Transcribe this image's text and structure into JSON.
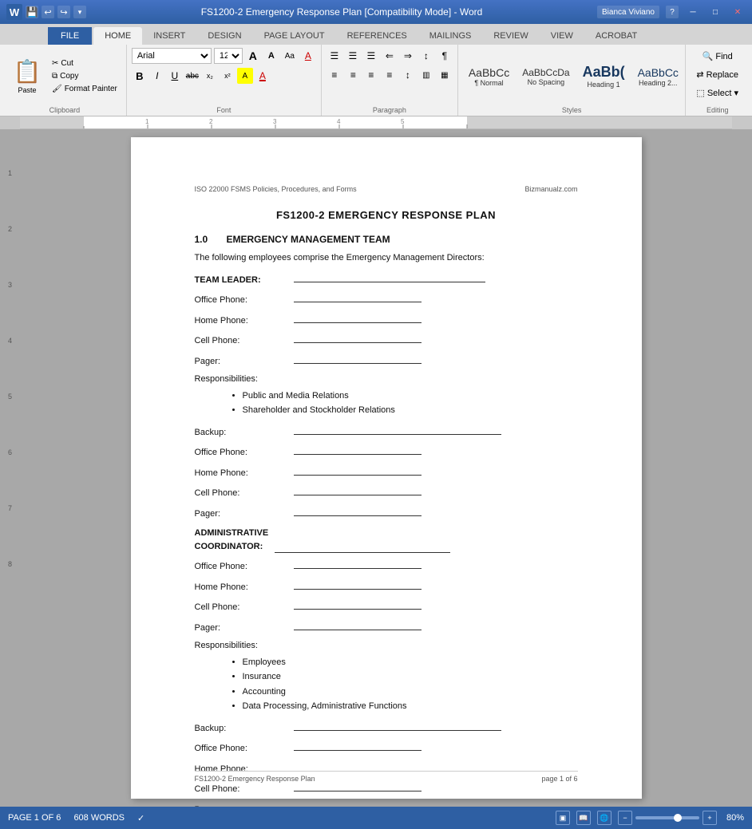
{
  "titleBar": {
    "appIcon": "W",
    "quickAccess": [
      "save",
      "undo",
      "redo",
      "customize"
    ],
    "title": "FS1200-2 Emergency Response Plan [Compatibility Mode] - Word",
    "userMenu": "Bianca Viviano",
    "windowBtns": [
      "help",
      "minimize",
      "maximize",
      "close"
    ]
  },
  "ribbon": {
    "tabs": [
      "FILE",
      "HOME",
      "INSERT",
      "DESIGN",
      "PAGE LAYOUT",
      "REFERENCES",
      "MAILINGS",
      "REVIEW",
      "VIEW",
      "ACROBAT"
    ],
    "activeTab": "HOME"
  },
  "clipboardGroup": {
    "label": "Clipboard",
    "pasteLabel": "Paste",
    "cutLabel": "Cut",
    "copyLabel": "Copy",
    "formatPainterLabel": "Format Painter"
  },
  "fontGroup": {
    "label": "Font",
    "fontName": "Arial",
    "fontSize": "12",
    "growLabel": "A",
    "shrinkLabel": "A",
    "caseLabel": "Aa",
    "clearLabel": "A",
    "boldLabel": "B",
    "italicLabel": "I",
    "underlineLabel": "U",
    "strikeLabel": "abc",
    "subscriptLabel": "x₂",
    "superscriptLabel": "x²",
    "highlightLabel": "A",
    "fontColorLabel": "A"
  },
  "paragraphGroup": {
    "label": "Paragraph",
    "bulletsLabel": "≡",
    "numbersLabel": "≡",
    "multiLabel": "≡",
    "decreaseLabel": "←",
    "increaseLabel": "→",
    "sortLabel": "↕",
    "showLabel": "¶",
    "alignLeftLabel": "≡",
    "centerLabel": "≡",
    "alignRightLabel": "≡",
    "justifyLabel": "≡",
    "lineSpacingLabel": "↕",
    "shadingLabel": "▥",
    "bordersLabel": "▦"
  },
  "stylesGroup": {
    "label": "Styles",
    "items": [
      {
        "name": "Normal",
        "preview": "AaBbCc",
        "label": "¶ Normal"
      },
      {
        "name": "NoSpacing",
        "preview": "AaBbCcDa",
        "label": "No Spacing"
      },
      {
        "name": "Heading1",
        "preview": "AaBb(",
        "label": "Heading 1"
      },
      {
        "name": "Heading2",
        "preview": "AaBbCc",
        "label": "Heading 2..."
      }
    ],
    "scrollUpLabel": "▲",
    "scrollDownLabel": "▼",
    "moreLabel": "▼"
  },
  "editingGroup": {
    "label": "Editing",
    "findLabel": "Find",
    "replaceLabel": "Replace",
    "selectLabel": "Select ▾"
  },
  "document": {
    "headerLeft": "ISO 22000 FSMS Policies, Procedures, and Forms",
    "headerRight": "Bizmanualz.com",
    "title": "FS1200-2 EMERGENCY RESPONSE PLAN",
    "sections": [
      {
        "number": "1.0",
        "heading": "EMERGENCY MANAGEMENT TEAM",
        "intro": "The following employees comprise the Emergency Management Directors:",
        "teamLeader": {
          "label": "TEAM LEADER:",
          "fields": [
            {
              "label": "Office Phone:",
              "lineWidth": "short"
            },
            {
              "label": "Home Phone:",
              "lineWidth": "short"
            },
            {
              "label": "Cell Phone:",
              "lineWidth": "short"
            },
            {
              "label": "Pager:",
              "lineWidth": "short"
            }
          ],
          "responsibilitiesLabel": "Responsibilities:",
          "responsibilities": [
            "Public and Media Relations",
            "Shareholder and Stockholder Relations"
          ],
          "backup": {
            "label": "Backup:",
            "fields": [
              {
                "label": "Office Phone:",
                "lineWidth": "short"
              },
              {
                "label": "Home Phone:",
                "lineWidth": "short"
              },
              {
                "label": "Cell Phone:",
                "lineWidth": "short"
              },
              {
                "label": "Pager:",
                "lineWidth": "short"
              }
            ]
          }
        },
        "adminCoordinator": {
          "label": "ADMINISTRATIVE COORDINATOR:",
          "fields": [
            {
              "label": "Office Phone:",
              "lineWidth": "short"
            },
            {
              "label": "Home Phone:",
              "lineWidth": "short"
            },
            {
              "label": "Cell Phone:",
              "lineWidth": "short"
            },
            {
              "label": "Pager:",
              "lineWidth": "short"
            }
          ],
          "responsibilitiesLabel": "Responsibilities:",
          "responsibilities": [
            "Employees",
            "Insurance",
            "Accounting",
            "Data Processing, Administrative Functions"
          ],
          "backup": {
            "label": "Backup:",
            "fields": [
              {
                "label": "Office Phone:",
                "lineWidth": "short"
              },
              {
                "label": "Home Phone:",
                "lineWidth": "short"
              },
              {
                "label": "Cell Phone:",
                "lineWidth": "short"
              },
              {
                "label": "Pager:",
                "lineWidth": "short"
              }
            ]
          }
        }
      }
    ],
    "footerLeft": "FS1200-2 Emergency Response Plan",
    "footerRight": "page 1 of 6"
  },
  "statusBar": {
    "pageInfo": "PAGE 1 OF 6",
    "wordCount": "608 WORDS",
    "proofingIcon": "✓",
    "viewButtons": [
      "print",
      "read",
      "web"
    ],
    "zoomLevel": "80%",
    "zoomMinus": "-",
    "zoomPlus": "+"
  }
}
